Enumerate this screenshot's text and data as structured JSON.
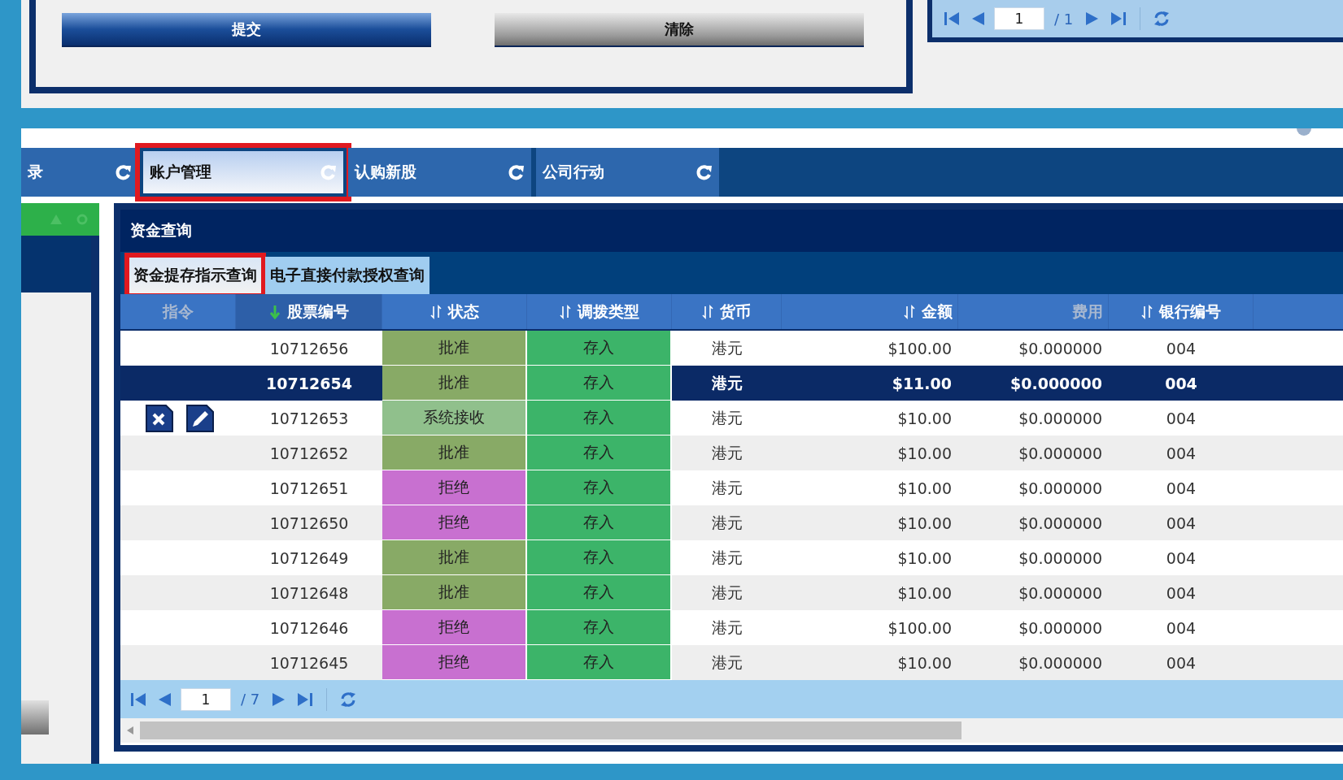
{
  "form": {
    "buttons": [
      {
        "label": "提交",
        "kind": "primary"
      },
      {
        "label": "清除",
        "kind": "secondary"
      }
    ]
  },
  "top_pager": {
    "page": "1",
    "total": "/ 1"
  },
  "tabs": [
    {
      "label": "录",
      "selected": false,
      "highlighted": false
    },
    {
      "label": "账户管理",
      "selected": true,
      "highlighted": true
    },
    {
      "label": "认购新股",
      "selected": false,
      "highlighted": false
    },
    {
      "label": "公司行动",
      "selected": false,
      "highlighted": false
    }
  ],
  "panel": {
    "title": "资金查询",
    "subtabs": [
      {
        "label": "资金提存指示查询",
        "selected": true,
        "highlighted": true
      },
      {
        "label": "电子直接付款授权查询",
        "selected": false,
        "highlighted": false
      }
    ]
  },
  "table": {
    "columns": [
      {
        "label": "指令",
        "sortable": false,
        "sorted": false
      },
      {
        "label": "股票编号",
        "sortable": true,
        "sorted": true
      },
      {
        "label": "状态",
        "sortable": true,
        "sorted": false
      },
      {
        "label": "调拨类型",
        "sortable": true,
        "sorted": false
      },
      {
        "label": "货币",
        "sortable": true,
        "sorted": false
      },
      {
        "label": "金额",
        "sortable": true,
        "sorted": false
      },
      {
        "label": "费用",
        "sortable": false,
        "sorted": false
      },
      {
        "label": "银行编号",
        "sortable": true,
        "sorted": false
      }
    ],
    "rows": [
      {
        "actions": false,
        "selected": false,
        "stock_no": "10712656",
        "status": {
          "text": "批准",
          "color": "#88aa66"
        },
        "type": {
          "text": "存入",
          "color": "#3cb469"
        },
        "currency": "港元",
        "amount": "$100.00",
        "fee": "$0.000000",
        "bank_no": "004"
      },
      {
        "actions": false,
        "selected": true,
        "stock_no": "10712654",
        "status": {
          "text": "批准",
          "color": "#88aa66"
        },
        "type": {
          "text": "存入",
          "color": "#3cb469"
        },
        "currency": "港元",
        "amount": "$11.00",
        "fee": "$0.000000",
        "bank_no": "004"
      },
      {
        "actions": true,
        "selected": false,
        "stock_no": "10712653",
        "status": {
          "text": "系统接收",
          "color": "#90c08c"
        },
        "type": {
          "text": "存入",
          "color": "#3cb469"
        },
        "currency": "港元",
        "amount": "$10.00",
        "fee": "$0.000000",
        "bank_no": "004"
      },
      {
        "actions": false,
        "selected": false,
        "stock_no": "10712652",
        "status": {
          "text": "批准",
          "color": "#88aa66"
        },
        "type": {
          "text": "存入",
          "color": "#3cb469"
        },
        "currency": "港元",
        "amount": "$10.00",
        "fee": "$0.000000",
        "bank_no": "004"
      },
      {
        "actions": false,
        "selected": false,
        "stock_no": "10712651",
        "status": {
          "text": "拒绝",
          "color": "#c870d0"
        },
        "type": {
          "text": "存入",
          "color": "#3cb469"
        },
        "currency": "港元",
        "amount": "$10.00",
        "fee": "$0.000000",
        "bank_no": "004"
      },
      {
        "actions": false,
        "selected": false,
        "stock_no": "10712650",
        "status": {
          "text": "拒绝",
          "color": "#c870d0"
        },
        "type": {
          "text": "存入",
          "color": "#3cb469"
        },
        "currency": "港元",
        "amount": "$10.00",
        "fee": "$0.000000",
        "bank_no": "004"
      },
      {
        "actions": false,
        "selected": false,
        "stock_no": "10712649",
        "status": {
          "text": "批准",
          "color": "#88aa66"
        },
        "type": {
          "text": "存入",
          "color": "#3cb469"
        },
        "currency": "港元",
        "amount": "$10.00",
        "fee": "$0.000000",
        "bank_no": "004"
      },
      {
        "actions": false,
        "selected": false,
        "stock_no": "10712648",
        "status": {
          "text": "批准",
          "color": "#88aa66"
        },
        "type": {
          "text": "存入",
          "color": "#3cb469"
        },
        "currency": "港元",
        "amount": "$10.00",
        "fee": "$0.000000",
        "bank_no": "004"
      },
      {
        "actions": false,
        "selected": false,
        "stock_no": "10712646",
        "status": {
          "text": "拒绝",
          "color": "#c870d0"
        },
        "type": {
          "text": "存入",
          "color": "#3cb469"
        },
        "currency": "港元",
        "amount": "$100.00",
        "fee": "$0.000000",
        "bank_no": "004"
      },
      {
        "actions": false,
        "selected": false,
        "stock_no": "10712645",
        "status": {
          "text": "拒绝",
          "color": "#c870d0"
        },
        "type": {
          "text": "存入",
          "color": "#3cb469"
        },
        "currency": "港元",
        "amount": "$10.00",
        "fee": "$0.000000",
        "bank_no": "004"
      }
    ]
  },
  "pager": {
    "page": "1",
    "total": "/ 7"
  }
}
